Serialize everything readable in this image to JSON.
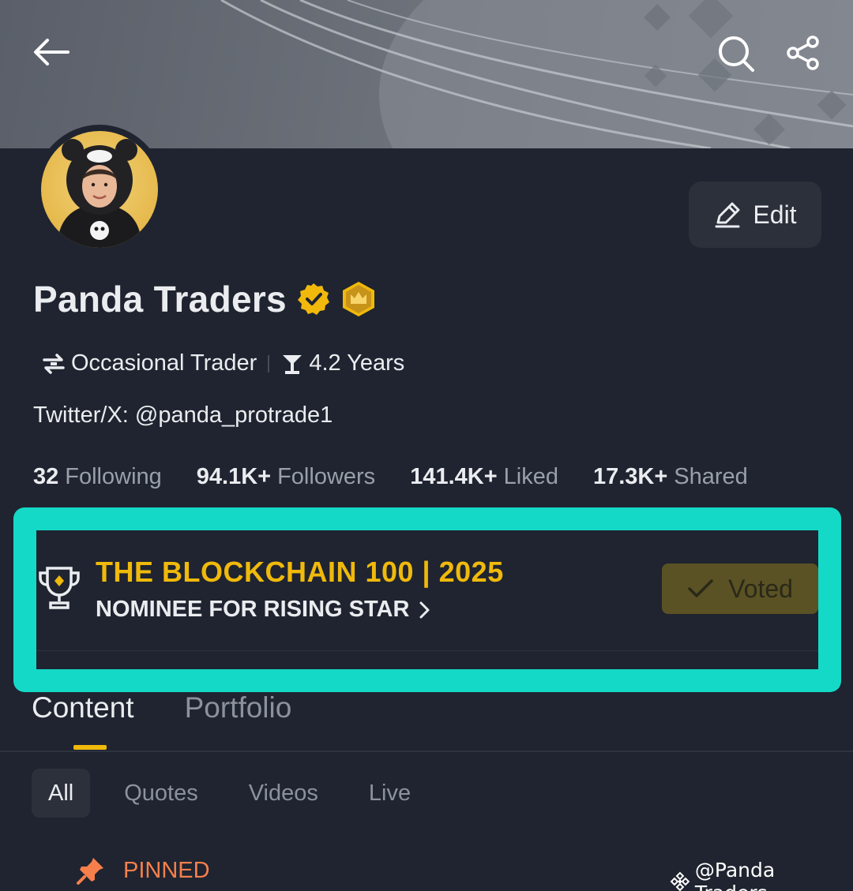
{
  "profile": {
    "name": "Panda Traders",
    "edit_label": "Edit",
    "trader_type": "Occasional Trader",
    "tenure": "4.2 Years",
    "bio": "Twitter/X: @panda_protrade1"
  },
  "stats": [
    {
      "value": "32",
      "label": "Following"
    },
    {
      "value": "94.1K+",
      "label": "Followers"
    },
    {
      "value": "141.4K+",
      "label": "Liked"
    },
    {
      "value": "17.3K+",
      "label": "Shared"
    }
  ],
  "award": {
    "title": "THE BLOCKCHAIN 100 | 2025",
    "subtitle": "NOMINEE FOR RISING STAR",
    "voted_label": "Voted"
  },
  "tabs": [
    {
      "label": "Content",
      "active": true
    },
    {
      "label": "Portfolio",
      "active": false
    }
  ],
  "subtabs": [
    {
      "label": "All",
      "active": true
    },
    {
      "label": "Quotes",
      "active": false
    },
    {
      "label": "Videos",
      "active": false
    },
    {
      "label": "Live",
      "active": false
    }
  ],
  "pinned_label": "PINNED",
  "watermark": "@Panda Traders",
  "icons": {
    "back": "arrow-left-icon",
    "search": "search-icon",
    "share": "share-icon",
    "edit": "pencil-icon",
    "verified": "verified-badge-icon",
    "crown": "crown-badge-icon",
    "trader_type": "swap-icon",
    "tenure": "trophy-small-icon",
    "award": "trophy-icon",
    "check": "check-icon",
    "chevron": "chevron-right-icon",
    "pin": "pin-icon",
    "binance": "binance-logo-icon"
  },
  "colors": {
    "accent": "#f0b90b",
    "highlight": "#14d9c7",
    "background": "#1f2430",
    "pinned": "#f77f4b"
  }
}
